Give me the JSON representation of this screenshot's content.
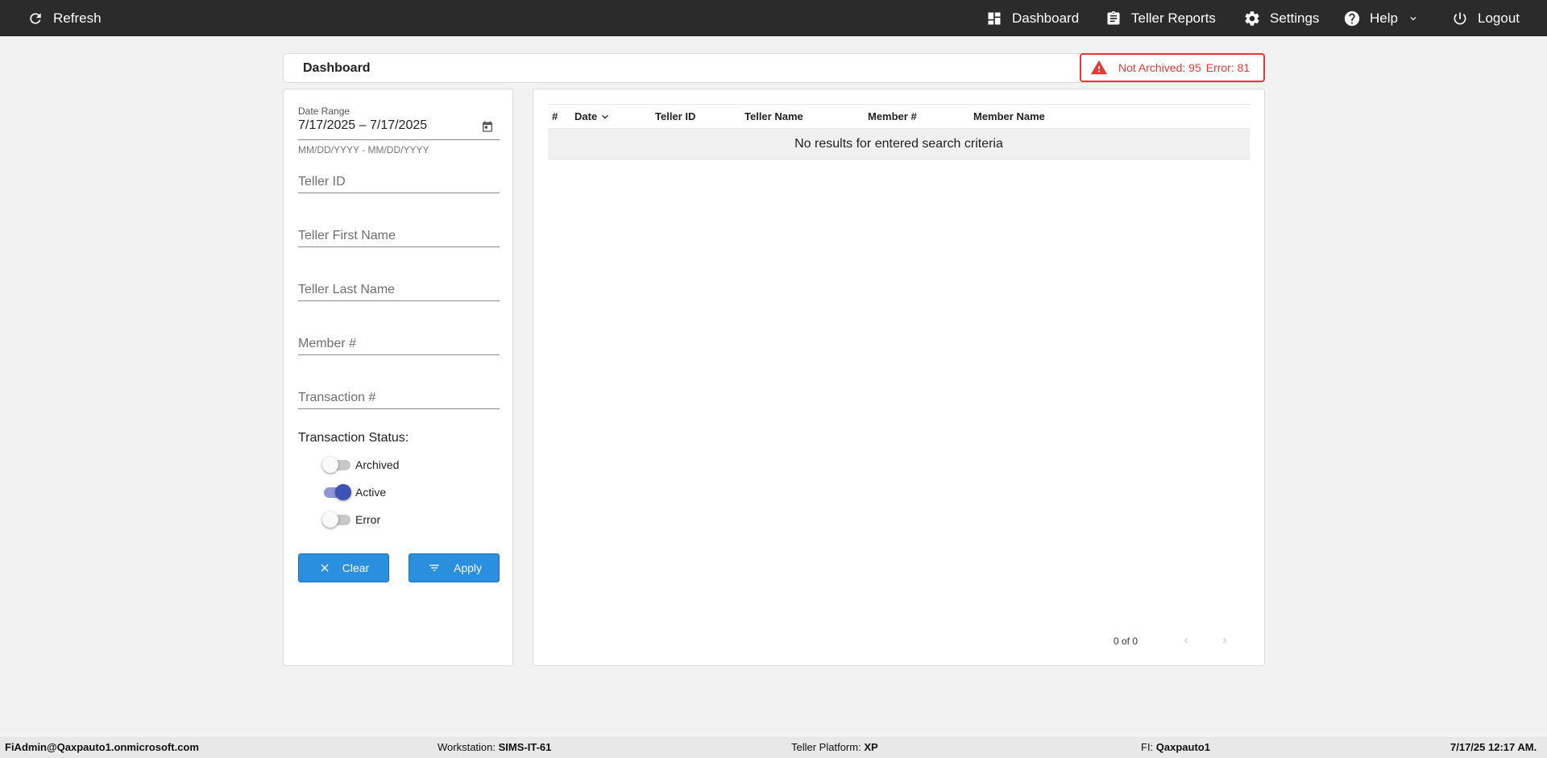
{
  "topbar": {
    "refresh_label": "Refresh",
    "dashboard_label": "Dashboard",
    "teller_reports_label": "Teller Reports",
    "settings_label": "Settings",
    "help_label": "Help",
    "logout_label": "Logout"
  },
  "header": {
    "title": "Dashboard",
    "alert": {
      "not_archived_label": "Not Archived: 95",
      "error_label": "Error: 81",
      "color": "#e53935"
    }
  },
  "filters": {
    "date_range_label": "Date Range",
    "date_range_value": "7/17/2025 – 7/17/2025",
    "date_hint": "MM/DD/YYYY - MM/DD/YYYY",
    "teller_id_placeholder": "Teller ID",
    "teller_first_name_placeholder": "Teller First Name",
    "teller_last_name_placeholder": "Teller Last Name",
    "member_number_placeholder": "Member #",
    "transaction_number_placeholder": "Transaction #",
    "status_title": "Transaction Status:",
    "statuses": [
      {
        "label": "Archived",
        "on": false
      },
      {
        "label": "Active",
        "on": true
      },
      {
        "label": "Error",
        "on": false
      }
    ],
    "clear_label": "Clear",
    "apply_label": "Apply",
    "accent_color": "#2b8fe0"
  },
  "results": {
    "columns": [
      "#",
      "Date",
      "Teller ID",
      "Teller Name",
      "Member #",
      "Member Name"
    ],
    "sort_column": "Date",
    "empty_message": "No results for entered search criteria",
    "pager_text": "0 of 0"
  },
  "footer": {
    "user": "FiAdmin@Qaxpauto1.onmicrosoft.com",
    "workstation_label": "Workstation:",
    "workstation_value": "SIMS-IT-61",
    "platform_label": "Teller Platform:",
    "platform_value": "XP",
    "fi_label": "FI:",
    "fi_value": "Qaxpauto1",
    "timestamp": "7/17/25 12:17 AM."
  }
}
